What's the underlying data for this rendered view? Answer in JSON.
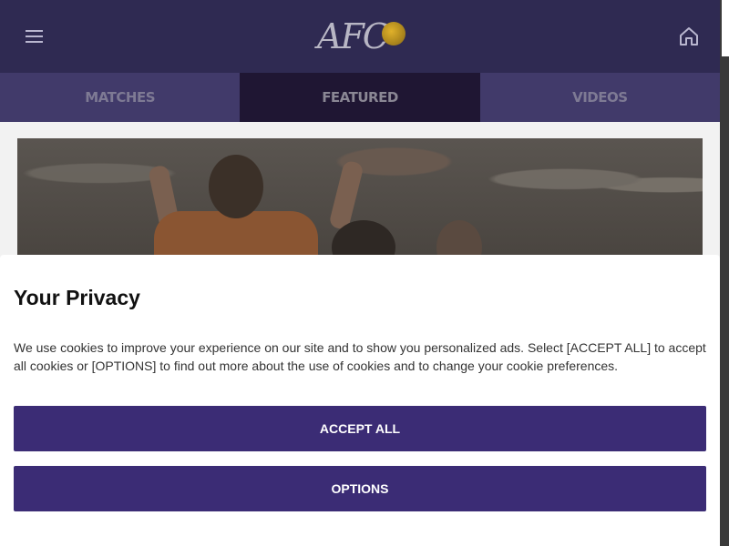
{
  "header": {
    "logo_text": "AFC",
    "menu_icon": "hamburger-menu-icon",
    "home_icon": "home-icon",
    "background": "#2f2a52"
  },
  "tabs": [
    {
      "label": "MATCHES",
      "active": false
    },
    {
      "label": "FEATURED",
      "active": true
    },
    {
      "label": "VIDEOS",
      "active": false
    }
  ],
  "privacy": {
    "title": "Your Privacy",
    "text": "We use cookies to improve your experience on our site and to show you personalized ads. Select [ACCEPT ALL] to accept all cookies or [OPTIONS] to find out more about the use of cookies and to change your cookie preferences.",
    "accept_label": "ACCEPT ALL",
    "options_label": "OPTIONS",
    "button_color": "#3b2c75"
  }
}
